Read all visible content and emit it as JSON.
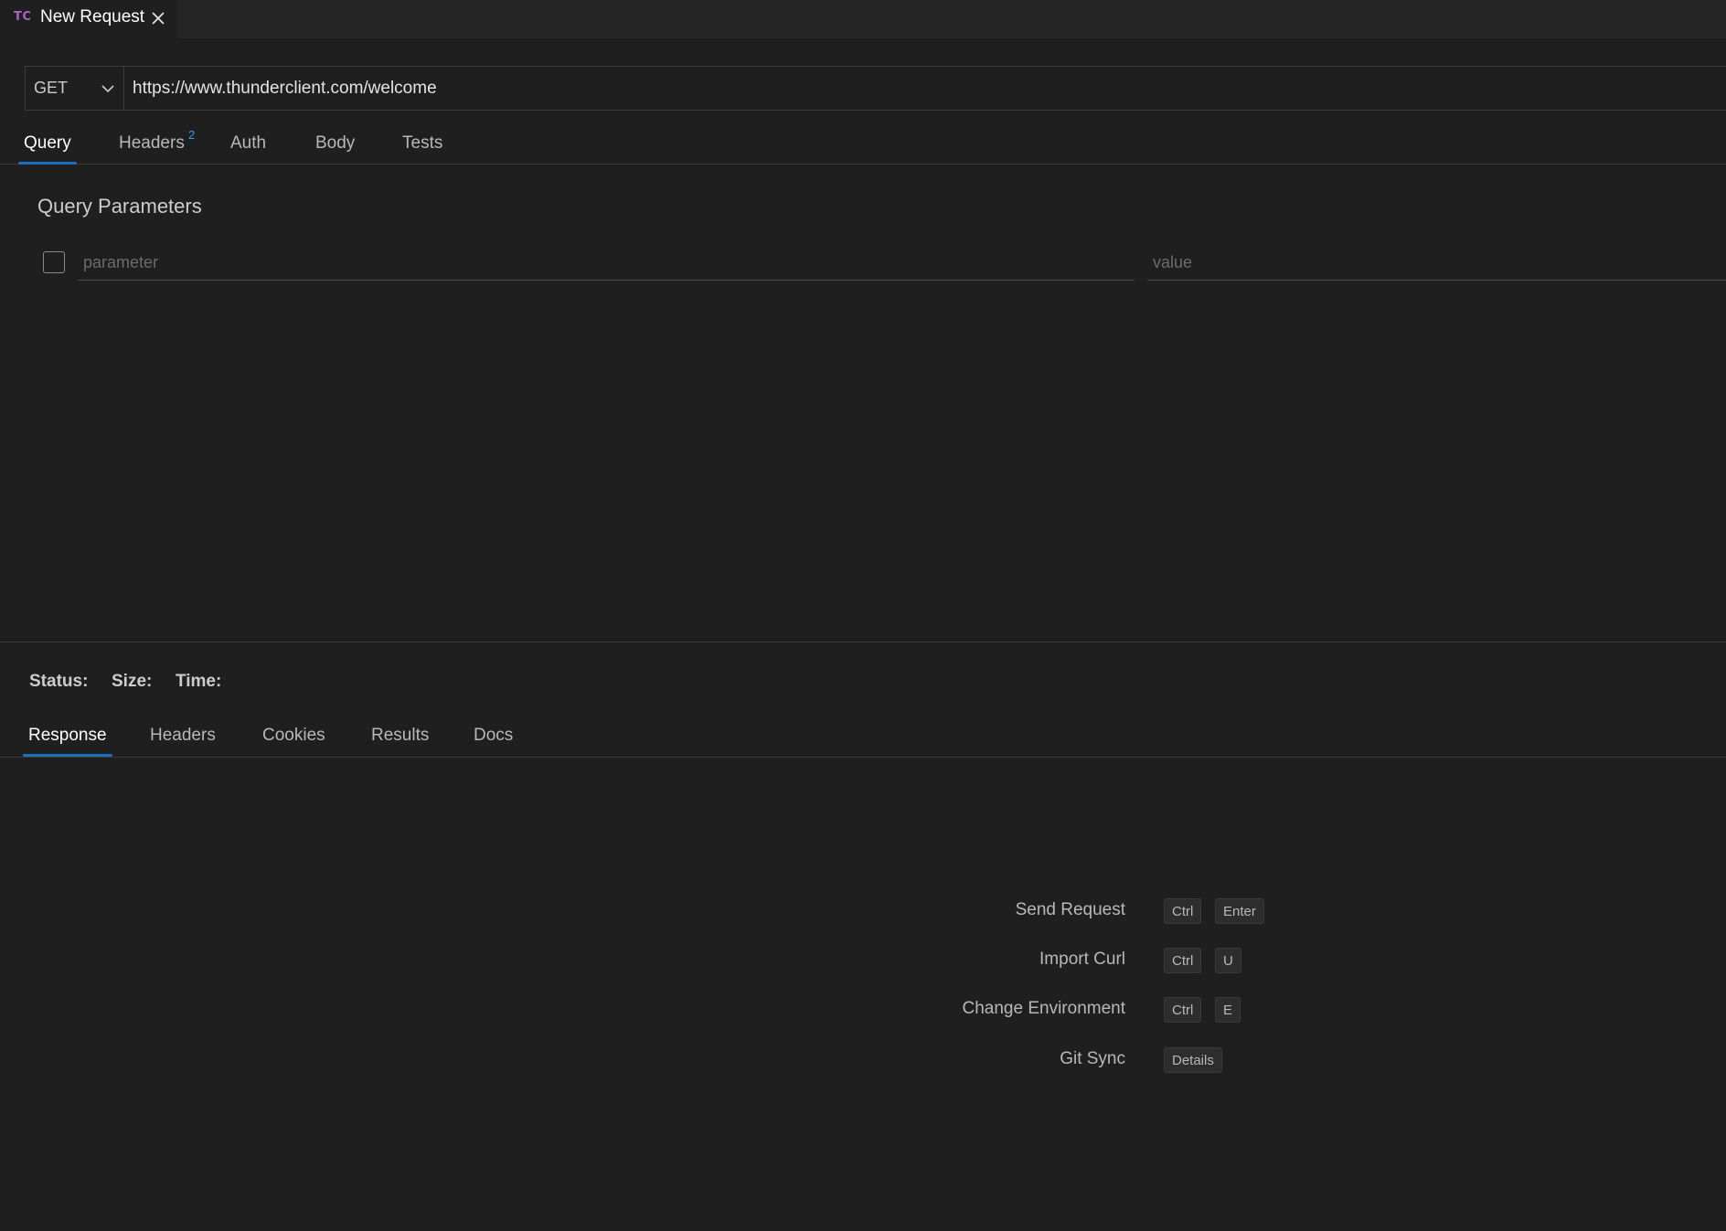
{
  "tab": {
    "logo": "TC",
    "title": "New Request"
  },
  "request": {
    "method": "GET",
    "url": "https://www.thunderclient.com/welcome"
  },
  "request_tabs": {
    "query": "Query",
    "headers": "Headers",
    "headers_count": "2",
    "auth": "Auth",
    "body": "Body",
    "tests": "Tests"
  },
  "query_params": {
    "title": "Query Parameters",
    "parameter_placeholder": "parameter",
    "value_placeholder": "value"
  },
  "status": {
    "status_label": "Status:",
    "size_label": "Size:",
    "time_label": "Time:"
  },
  "response_tabs": {
    "response": "Response",
    "headers": "Headers",
    "cookies": "Cookies",
    "results": "Results",
    "docs": "Docs"
  },
  "shortcuts": [
    {
      "label": "Send Request",
      "keys": [
        "Ctrl",
        "Enter"
      ]
    },
    {
      "label": "Import Curl",
      "keys": [
        "Ctrl",
        "U"
      ]
    },
    {
      "label": "Change Environment",
      "keys": [
        "Ctrl",
        "E"
      ]
    },
    {
      "label": "Git Sync",
      "keys": [
        "Details"
      ]
    }
  ],
  "colors": {
    "background": "#1f1f1f",
    "active_tab_underline": "#1e6fbf",
    "logo": "#b160c9",
    "badge": "#3794ff"
  }
}
